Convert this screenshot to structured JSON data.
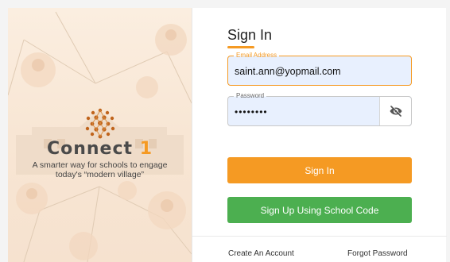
{
  "brand": {
    "name_word": "Connect",
    "name_number": "1",
    "tagline_line1": "A smarter way for schools to engage",
    "tagline_line2": "today's “modern village”"
  },
  "form": {
    "title": "Sign In",
    "email": {
      "label": "Email Address",
      "value": "saint.ann@yopmail.com"
    },
    "password": {
      "label": "Password",
      "value": "Password"
    },
    "signin_label": "Sign In",
    "signup_label": "Sign Up Using School Code"
  },
  "footer": {
    "create_account": "Create An Account",
    "forgot_password": "Forgot Password"
  },
  "icons": {
    "password_toggle": "eye-off-icon",
    "logo": "connect-network-logo-icon"
  },
  "colors": {
    "accent_orange": "#f59a23",
    "success_green": "#4caf50",
    "input_fill": "#e8f0fe",
    "left_panel_bg": "#f8e6d4"
  }
}
